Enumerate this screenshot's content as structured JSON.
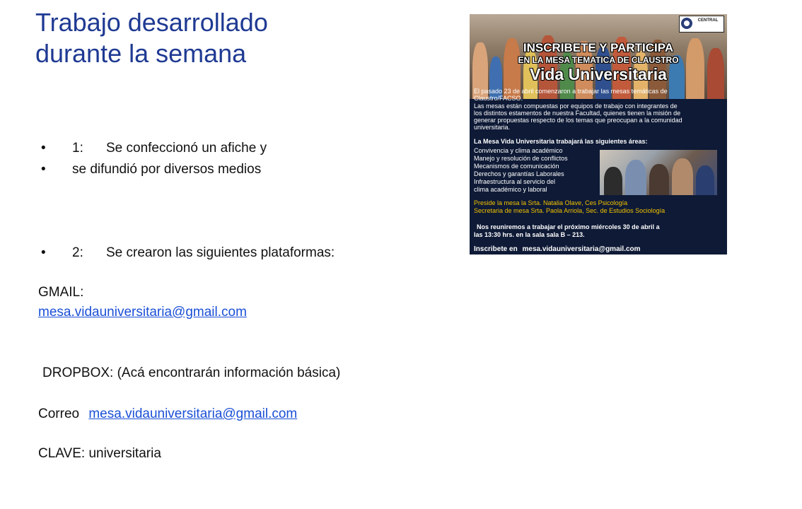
{
  "title": {
    "line1": "Trabajo desarrollado",
    "line2": "durante la semana"
  },
  "bullets": [
    {
      "dot": "•",
      "num": "1:",
      "text": "Se confeccionó un afiche y"
    },
    {
      "dot": "•",
      "text": "se difundió por diversos medios"
    },
    {
      "dot": "•",
      "num": "2:",
      "text": "Se crearon las siguientes plataformas:"
    }
  ],
  "gmail": {
    "label": "GMAIL:",
    "email": "mesa.vidauniversitaria@gmail.com"
  },
  "dropbox": {
    "label": "DROPBOX: (Acá encontrarán información básica)",
    "correo_label": "Correo",
    "correo_email": "mesa.vidauniversitaria@gmail.com",
    "clave": "CLAVE: universitaria"
  },
  "poster": {
    "logo_text": "CENTRAL",
    "headline1": "INSCRIBETE  Y  PARTICIPA",
    "headline2": "EN LA MESA TEMATICA  DE CLAUSTRO",
    "headline3": "Vida Universitaria",
    "intro": [
      "El   pasado   23 de abril comenzaron a trabajar las mesas temáticas  de",
      "Claustro/FACSO.",
      "Las mesas están compuestas por equipos  de trabajo  con integrantes de",
      "los distintos estamentos de nuestra Facultad, quienes tienen la misión de",
      "generar propuestas respecto de los temas que preocupan a la comunidad",
      "universitaria."
    ],
    "areas_title": "La Mesa Vida Universitaria trabajará  las siguientes áreas:",
    "areas": [
      "Convivencia y clima académico",
      "Manejo y resolución de conflictos",
      "Mecanismos de comunicación",
      "Derechos y garantías Laborales",
      "Infraestructura al servicio del",
      "clima académico y laboral"
    ],
    "preside": [
      "Preside la mesa la Srta. Natalia Olave, Ces Psicología",
      "Secretaria de mesa Srta. Paola Arriola, Sec. de Estudios Sociología"
    ],
    "reunion": [
      "Nos reuniremos   a trabajar el próximo miércoles 30 de abril  a",
      "las 13:30 hrs. en la sala  sala B – 213."
    ],
    "inscribete_label": "Inscribete en",
    "inscribete_email": "mesa.vidauniversitaria@gmail.com"
  }
}
